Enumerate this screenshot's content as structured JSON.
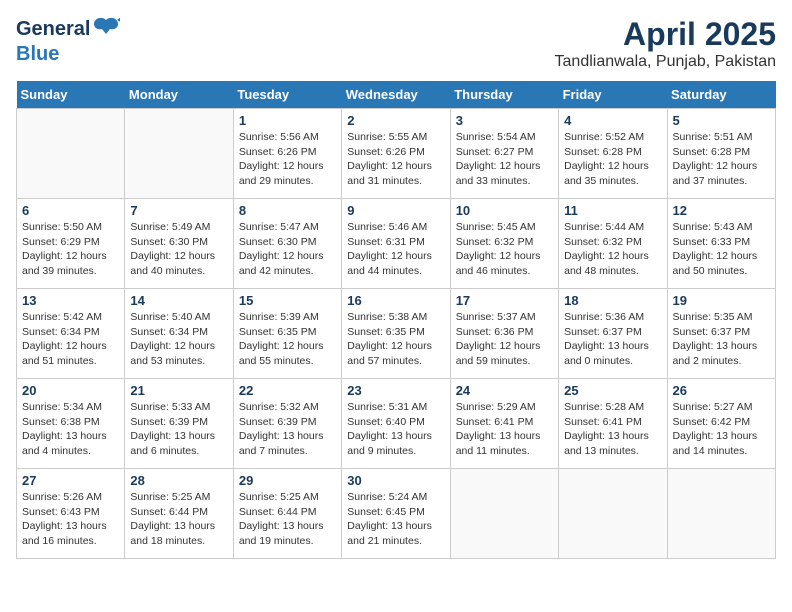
{
  "header": {
    "logo_general": "General",
    "logo_blue": "Blue",
    "month_title": "April 2025",
    "location": "Tandlianwala, Punjab, Pakistan"
  },
  "days_of_week": [
    "Sunday",
    "Monday",
    "Tuesday",
    "Wednesday",
    "Thursday",
    "Friday",
    "Saturday"
  ],
  "weeks": [
    [
      {
        "day": "",
        "info": ""
      },
      {
        "day": "",
        "info": ""
      },
      {
        "day": "1",
        "info": "Sunrise: 5:56 AM\nSunset: 6:26 PM\nDaylight: 12 hours\nand 29 minutes."
      },
      {
        "day": "2",
        "info": "Sunrise: 5:55 AM\nSunset: 6:26 PM\nDaylight: 12 hours\nand 31 minutes."
      },
      {
        "day": "3",
        "info": "Sunrise: 5:54 AM\nSunset: 6:27 PM\nDaylight: 12 hours\nand 33 minutes."
      },
      {
        "day": "4",
        "info": "Sunrise: 5:52 AM\nSunset: 6:28 PM\nDaylight: 12 hours\nand 35 minutes."
      },
      {
        "day": "5",
        "info": "Sunrise: 5:51 AM\nSunset: 6:28 PM\nDaylight: 12 hours\nand 37 minutes."
      }
    ],
    [
      {
        "day": "6",
        "info": "Sunrise: 5:50 AM\nSunset: 6:29 PM\nDaylight: 12 hours\nand 39 minutes."
      },
      {
        "day": "7",
        "info": "Sunrise: 5:49 AM\nSunset: 6:30 PM\nDaylight: 12 hours\nand 40 minutes."
      },
      {
        "day": "8",
        "info": "Sunrise: 5:47 AM\nSunset: 6:30 PM\nDaylight: 12 hours\nand 42 minutes."
      },
      {
        "day": "9",
        "info": "Sunrise: 5:46 AM\nSunset: 6:31 PM\nDaylight: 12 hours\nand 44 minutes."
      },
      {
        "day": "10",
        "info": "Sunrise: 5:45 AM\nSunset: 6:32 PM\nDaylight: 12 hours\nand 46 minutes."
      },
      {
        "day": "11",
        "info": "Sunrise: 5:44 AM\nSunset: 6:32 PM\nDaylight: 12 hours\nand 48 minutes."
      },
      {
        "day": "12",
        "info": "Sunrise: 5:43 AM\nSunset: 6:33 PM\nDaylight: 12 hours\nand 50 minutes."
      }
    ],
    [
      {
        "day": "13",
        "info": "Sunrise: 5:42 AM\nSunset: 6:34 PM\nDaylight: 12 hours\nand 51 minutes."
      },
      {
        "day": "14",
        "info": "Sunrise: 5:40 AM\nSunset: 6:34 PM\nDaylight: 12 hours\nand 53 minutes."
      },
      {
        "day": "15",
        "info": "Sunrise: 5:39 AM\nSunset: 6:35 PM\nDaylight: 12 hours\nand 55 minutes."
      },
      {
        "day": "16",
        "info": "Sunrise: 5:38 AM\nSunset: 6:35 PM\nDaylight: 12 hours\nand 57 minutes."
      },
      {
        "day": "17",
        "info": "Sunrise: 5:37 AM\nSunset: 6:36 PM\nDaylight: 12 hours\nand 59 minutes."
      },
      {
        "day": "18",
        "info": "Sunrise: 5:36 AM\nSunset: 6:37 PM\nDaylight: 13 hours\nand 0 minutes."
      },
      {
        "day": "19",
        "info": "Sunrise: 5:35 AM\nSunset: 6:37 PM\nDaylight: 13 hours\nand 2 minutes."
      }
    ],
    [
      {
        "day": "20",
        "info": "Sunrise: 5:34 AM\nSunset: 6:38 PM\nDaylight: 13 hours\nand 4 minutes."
      },
      {
        "day": "21",
        "info": "Sunrise: 5:33 AM\nSunset: 6:39 PM\nDaylight: 13 hours\nand 6 minutes."
      },
      {
        "day": "22",
        "info": "Sunrise: 5:32 AM\nSunset: 6:39 PM\nDaylight: 13 hours\nand 7 minutes."
      },
      {
        "day": "23",
        "info": "Sunrise: 5:31 AM\nSunset: 6:40 PM\nDaylight: 13 hours\nand 9 minutes."
      },
      {
        "day": "24",
        "info": "Sunrise: 5:29 AM\nSunset: 6:41 PM\nDaylight: 13 hours\nand 11 minutes."
      },
      {
        "day": "25",
        "info": "Sunrise: 5:28 AM\nSunset: 6:41 PM\nDaylight: 13 hours\nand 13 minutes."
      },
      {
        "day": "26",
        "info": "Sunrise: 5:27 AM\nSunset: 6:42 PM\nDaylight: 13 hours\nand 14 minutes."
      }
    ],
    [
      {
        "day": "27",
        "info": "Sunrise: 5:26 AM\nSunset: 6:43 PM\nDaylight: 13 hours\nand 16 minutes."
      },
      {
        "day": "28",
        "info": "Sunrise: 5:25 AM\nSunset: 6:44 PM\nDaylight: 13 hours\nand 18 minutes."
      },
      {
        "day": "29",
        "info": "Sunrise: 5:25 AM\nSunset: 6:44 PM\nDaylight: 13 hours\nand 19 minutes."
      },
      {
        "day": "30",
        "info": "Sunrise: 5:24 AM\nSunset: 6:45 PM\nDaylight: 13 hours\nand 21 minutes."
      },
      {
        "day": "",
        "info": ""
      },
      {
        "day": "",
        "info": ""
      },
      {
        "day": "",
        "info": ""
      }
    ]
  ]
}
